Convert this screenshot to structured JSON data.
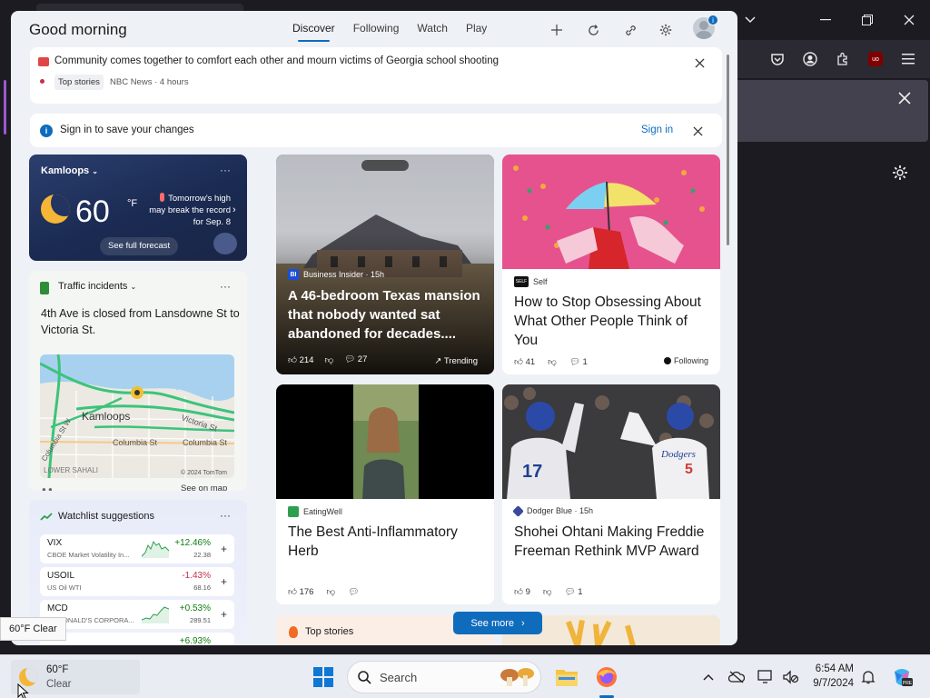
{
  "panel": {
    "greeting": "Good morning",
    "tabs": [
      {
        "label": "Discover",
        "active": true
      },
      {
        "label": "Following",
        "active": false
      },
      {
        "label": "Watch",
        "active": false
      },
      {
        "label": "Play",
        "active": false
      }
    ],
    "header_icons": [
      "add-icon",
      "refresh-icon",
      "share-icon",
      "settings-icon",
      "profile-avatar"
    ],
    "avatar_badge": "i"
  },
  "news_banner": {
    "headline": "Community comes together to comfort each other and mourn victims of Georgia school shooting",
    "tag": "Top stories",
    "source": "NBC News · 4 hours"
  },
  "signin": {
    "message": "Sign in to save your changes",
    "link": "Sign in"
  },
  "weather": {
    "location": "Kamloops",
    "temp": "60",
    "unit": "°F",
    "record_line1": "Tomorrow's high",
    "record_line2": "may break the record",
    "record_line3": "for Sep. 8",
    "forecast_label": "See full forecast"
  },
  "traffic": {
    "title": "Traffic incidents",
    "body": "4th Ave is closed from Lansdowne St to Victoria St.",
    "map_labels": [
      "Kamloops",
      "Victoria St",
      "Columbia St",
      "Columbia St",
      "Columbia St W",
      "LOWER SAHALI",
      "© 2024 TomTom"
    ],
    "see_on_map": "See on map"
  },
  "watchlist": {
    "title": "Watchlist suggestions",
    "stocks": [
      {
        "symbol": "VIX",
        "name": "CBOE Market Volatility In...",
        "change": "+12.46%",
        "price": "22.38",
        "up": true
      },
      {
        "symbol": "USOIL",
        "name": "US Oil WTI",
        "change": "-1.43%",
        "price": "68.16",
        "up": false
      },
      {
        "symbol": "MCD",
        "name": "MCDONALD'S CORPORA...",
        "change": "+0.53%",
        "price": "289.51",
        "up": true
      }
    ],
    "partial_change": "+6.93%"
  },
  "feed": {
    "hero": {
      "publisher": "Business Insider · 15h",
      "headline": "A 46-bedroom Texas mansion that nobody wanted sat abandoned for decades....",
      "likes": "214",
      "comments": "27",
      "trending": "Trending"
    },
    "self": {
      "publisher": "Self",
      "headline": "How to Stop Obsessing About What Other People Think of You",
      "likes": "41",
      "comments": "1",
      "following": "Following"
    },
    "eatingwell": {
      "publisher": "EatingWell",
      "headline": "The Best Anti-Inflammatory Herb",
      "likes": "176"
    },
    "dodger": {
      "publisher": "Dodger Blue · 15h",
      "headline": "Shohei Ohtani Making Freddie Freeman Rethink MVP Award",
      "likes": "9",
      "comments": "1",
      "jersey_left": "17",
      "jersey_right": "5",
      "team_text": "Dodgers"
    },
    "top_stories": "Top stories",
    "see_more": "See more"
  },
  "tooltip": "60°F Clear",
  "taskbar": {
    "weather_temp": "60°F",
    "weather_cond": "Clear",
    "search_label": "Search",
    "time": "6:54 AM",
    "date": "9/7/2024"
  },
  "colors": {
    "accent": "#0f6cbd",
    "positive": "#107c10",
    "negative": "#c4314b"
  }
}
